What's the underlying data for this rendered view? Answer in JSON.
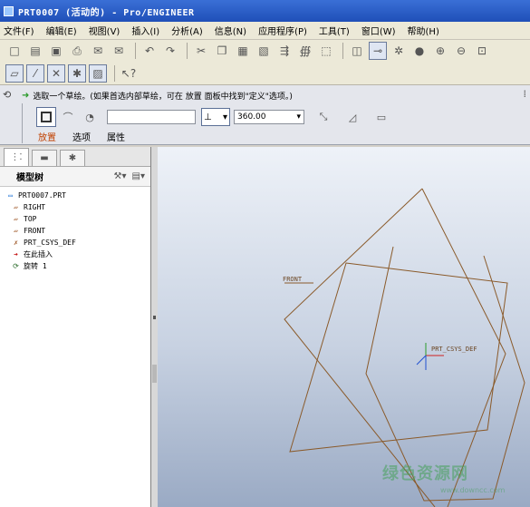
{
  "window": {
    "title": "PRT0007 (活动的) - Pro/ENGINEER"
  },
  "menubar": {
    "items": [
      {
        "label": "文件(F)"
      },
      {
        "label": "编辑(E)"
      },
      {
        "label": "视图(V)"
      },
      {
        "label": "插入(I)"
      },
      {
        "label": "分析(A)"
      },
      {
        "label": "信息(N)"
      },
      {
        "label": "应用程序(P)"
      },
      {
        "label": "工具(T)"
      },
      {
        "label": "窗口(W)"
      },
      {
        "label": "帮助(H)"
      }
    ]
  },
  "toolbar": {
    "row1": [
      "new-icon",
      "open-icon",
      "save-icon",
      "print-icon",
      "email-icon",
      "email2-icon",
      "undo-icon",
      "redo-icon",
      "cut-icon",
      "copy-icon",
      "paste-icon",
      "paste-special-icon",
      "regenerate-icon",
      "find-icon",
      "select-box-icon",
      "repaint-icon",
      "orient-icon",
      "spin-center-icon",
      "shade-icon",
      "zoom-in-icon",
      "zoom-out-icon",
      "refit-icon"
    ],
    "row2": [
      "datum-plane-icon",
      "datum-axis-icon",
      "datum-point-icon",
      "csys-icon",
      "annotation-icon",
      "help-context-icon"
    ]
  },
  "dashboard": {
    "message": "选取一个草绘。(如果首选内部草绘，可在 放置 面板中找到\"定义\"选项。)",
    "angle_value": "360.00",
    "tabs": [
      {
        "label": "放置",
        "active": true
      },
      {
        "label": "选项",
        "active": false
      },
      {
        "label": "属性",
        "active": false
      }
    ]
  },
  "model_tree": {
    "title": "模型树",
    "items": [
      {
        "label": "PRT0007.PRT",
        "icon": "part-icon",
        "level": 0
      },
      {
        "label": "RIGHT",
        "icon": "datum-plane-icon",
        "level": 1
      },
      {
        "label": "TOP",
        "icon": "datum-plane-icon",
        "level": 1
      },
      {
        "label": "FRONT",
        "icon": "datum-plane-icon",
        "level": 1
      },
      {
        "label": "PRT_CSYS_DEF",
        "icon": "csys-icon",
        "level": 1
      },
      {
        "label": "在此插入",
        "icon": "insert-here-icon",
        "level": 1
      },
      {
        "label": "旋转 1",
        "icon": "revolve-icon",
        "level": 1
      }
    ]
  },
  "graphics": {
    "labels": {
      "front_plane": "FRONT",
      "csys": "PRT_CSYS_DEF"
    },
    "datum_color": "#8a5a2a",
    "watermark": "绿色资源网",
    "watermark_url": "www.downcc.com"
  }
}
